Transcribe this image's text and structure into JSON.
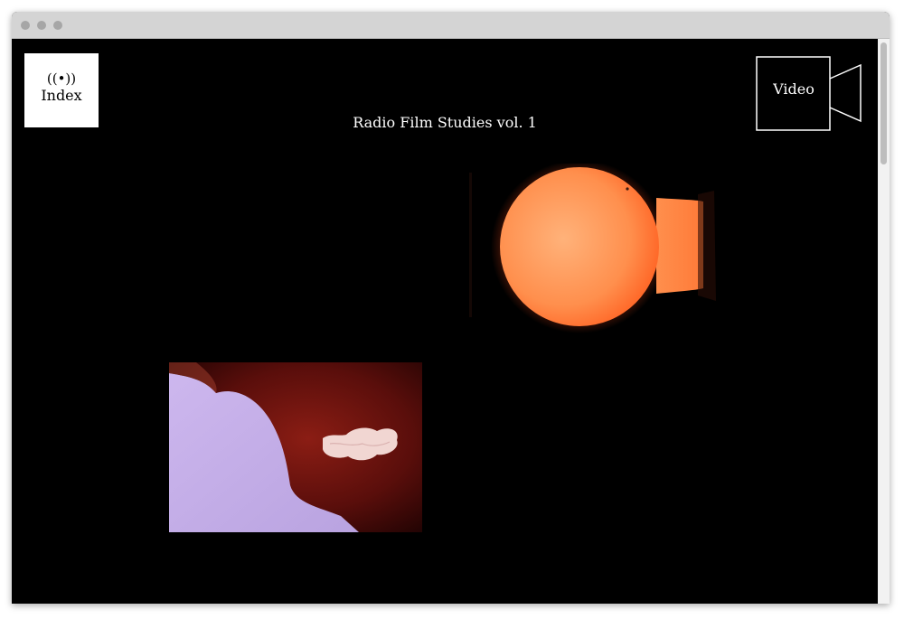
{
  "nav": {
    "index_symbol": "((•))",
    "index_label": "Index",
    "video_label": "Video"
  },
  "page": {
    "title": "Radio Film Studies vol. 1"
  },
  "colors": {
    "background": "#000000",
    "text": "#ffffff",
    "index_box": "#ffffff",
    "bulb_orange": "#ff8f4d",
    "cloud_lavender": "#c9b3ea",
    "cloud_red": "#7a1410"
  }
}
